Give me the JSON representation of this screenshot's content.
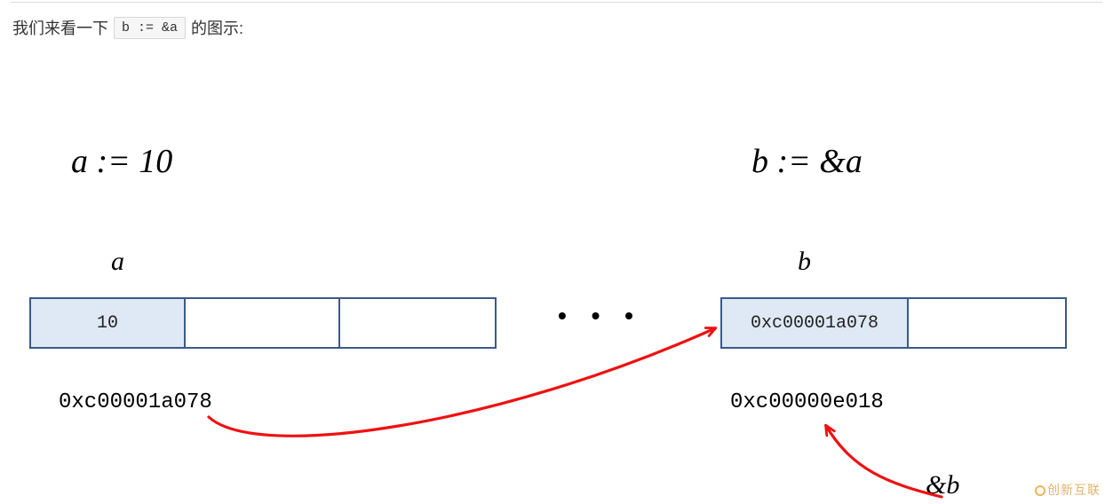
{
  "intro": {
    "prefix": "我们来看一下",
    "code": "b := &a",
    "suffix": "的图示:"
  },
  "declarations": {
    "a": "a := 10",
    "b": "b := &a"
  },
  "labels": {
    "a": "a",
    "b": "b"
  },
  "memory": {
    "a_cells": [
      "10",
      "",
      ""
    ],
    "ellipsis": "• • •",
    "b_cells": [
      "0xc00001a078",
      ""
    ]
  },
  "addresses": {
    "a": "0xc00001a078",
    "b": "0xc00000e018"
  },
  "amp_b": "&b",
  "watermark": "创新互联"
}
